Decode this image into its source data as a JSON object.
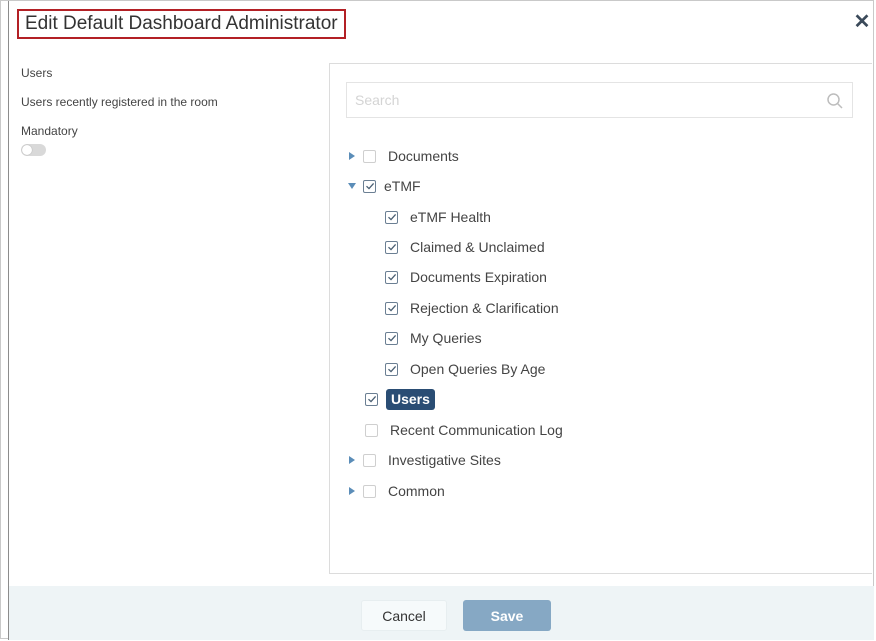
{
  "dialog": {
    "title": "Edit Default Dashboard Administrator",
    "close_icon": "close-icon"
  },
  "left_panel": {
    "users_label": "Users",
    "description": "Users recently registered in the room",
    "mandatory_label": "Mandatory",
    "mandatory_on": false
  },
  "search": {
    "placeholder": "Search",
    "value": "",
    "icon": "search-icon"
  },
  "tree": {
    "documents": {
      "label": "Documents",
      "checked": false,
      "expanded": false
    },
    "etmf": {
      "label": "eTMF",
      "checked": true,
      "expanded": true
    },
    "etmf_children": [
      {
        "label": "eTMF Health",
        "checked": true
      },
      {
        "label": "Claimed & Unclaimed",
        "checked": true
      },
      {
        "label": "Documents Expiration",
        "checked": true
      },
      {
        "label": "Rejection & Clarification",
        "checked": true
      },
      {
        "label": "My Queries",
        "checked": true
      },
      {
        "label": "Open Queries By Age",
        "checked": true
      }
    ],
    "users": {
      "label": "Users",
      "checked": true,
      "selected": true
    },
    "recent_log": {
      "label": "Recent Communication Log",
      "checked": false
    },
    "investigative_sites": {
      "label": "Investigative Sites",
      "checked": false,
      "expanded": false
    },
    "common": {
      "label": "Common",
      "checked": false,
      "expanded": false
    }
  },
  "footer": {
    "cancel_label": "Cancel",
    "save_label": "Save"
  },
  "colors": {
    "title_border": "#b32025",
    "selected_chip": "#2a4d74",
    "save_button": "#86a8c4",
    "footer_bg": "#eef4f6",
    "tree_arrow": "#5b8db8"
  }
}
